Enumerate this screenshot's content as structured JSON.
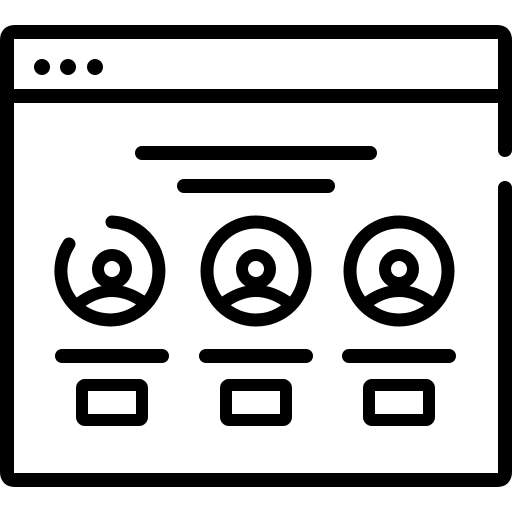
{
  "icon": {
    "name": "browser-window-team-profiles-icon",
    "stroke_color": "#000000",
    "background_color": "#ffffff",
    "window_dots": 3,
    "profile_cards": [
      {
        "avatar": "user-avatar-icon",
        "name_line": true,
        "button": true
      },
      {
        "avatar": "user-avatar-icon",
        "name_line": true,
        "button": true
      },
      {
        "avatar": "user-avatar-icon",
        "name_line": true,
        "button": true
      }
    ]
  }
}
